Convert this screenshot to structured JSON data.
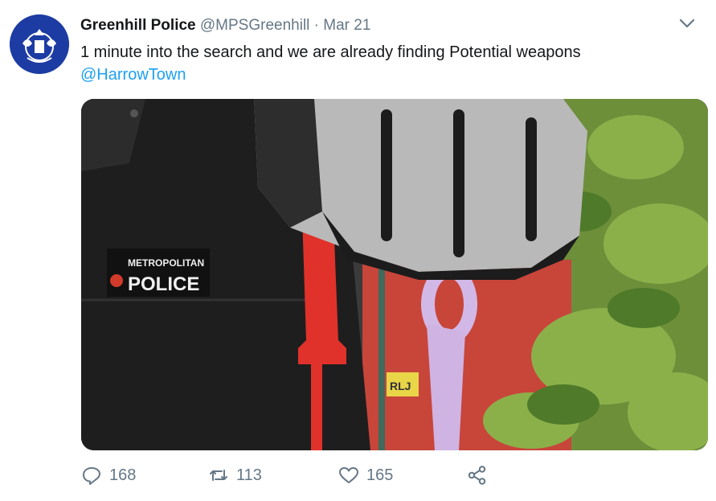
{
  "tweet": {
    "author_name": "Greenhill Police",
    "handle": "@MPSGreenhill",
    "separator": "·",
    "date": "Mar 21",
    "text": "1 minute into the search and we are already finding Potential weapons",
    "mention": "@HarrowTown"
  },
  "media": {
    "patch_line1": "METROPOLITAN",
    "patch_line2": "POLICE",
    "car_plate_fragment": "RLJ"
  },
  "actions": {
    "replies": "168",
    "retweets": "113",
    "likes": "165"
  },
  "icons": {
    "menu": "chevron-down-icon",
    "reply": "reply-icon",
    "retweet": "retweet-icon",
    "like": "heart-icon",
    "share": "share-icon"
  },
  "colors": {
    "accent": "#1da1f2",
    "meta_text": "#657786",
    "avatar_bg": "#1d3ca3"
  }
}
